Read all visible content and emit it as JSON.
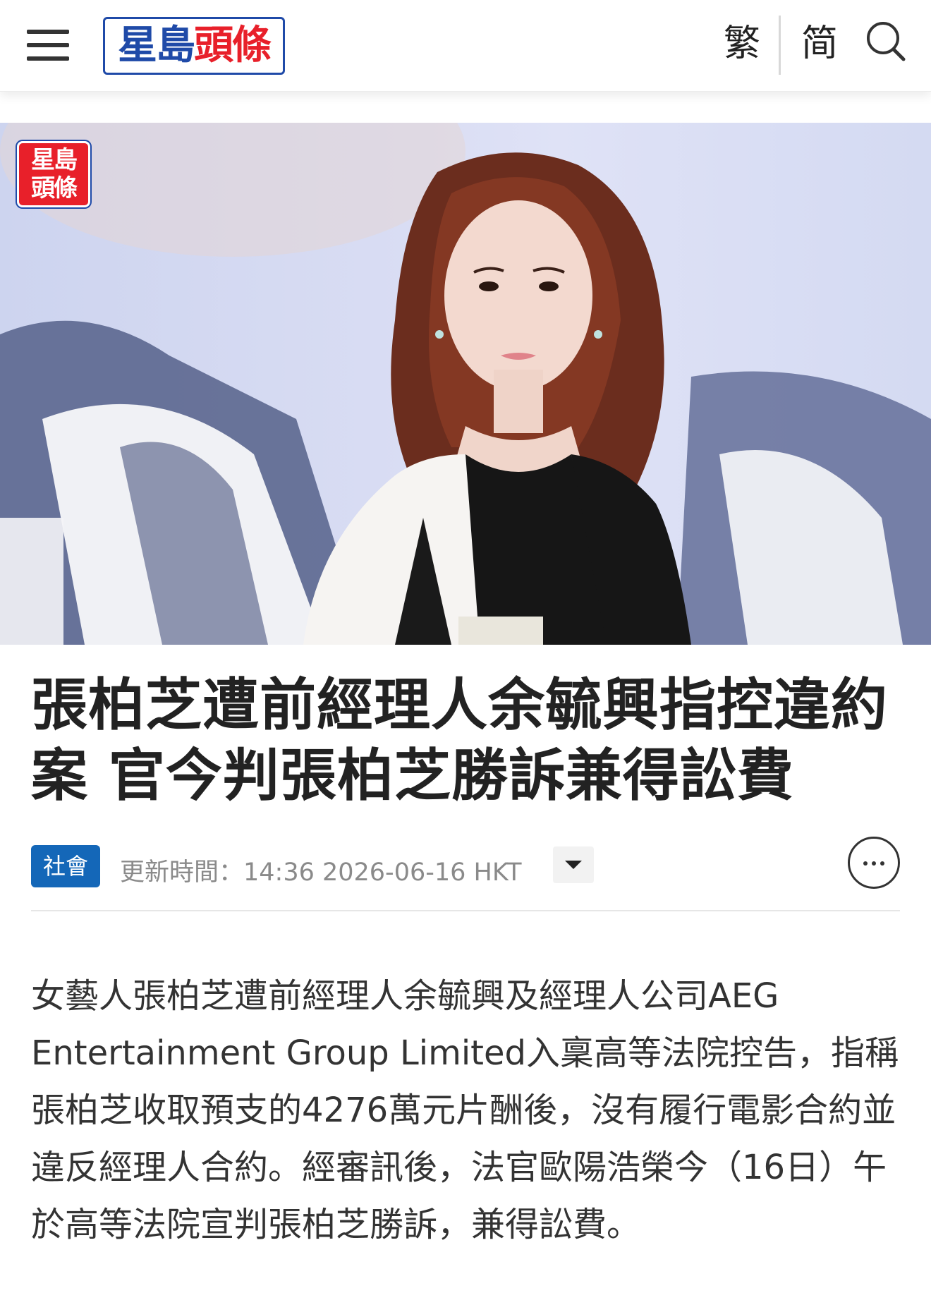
{
  "header": {
    "menu_icon": "hamburger-menu-icon",
    "logo_text_part1": "星島",
    "logo_text_part2": "頭條",
    "lang_traditional": "繁",
    "lang_simplified": "简",
    "search_icon": "search-icon"
  },
  "hero": {
    "watermark_line1": "星島",
    "watermark_line2": "頭條"
  },
  "article": {
    "headline": "張柏芝遭前經理人余毓興指控違約案 官今判張柏芝勝訴兼得訟費",
    "category": "社會",
    "update_time": "更新時間：14:36 2026-06-16 HKT",
    "expand_icon": "caret-down-icon",
    "more_icon": "more-options-icon",
    "body": "女藝人張柏芝遭前經理人余毓興及經理人公司AEG Entertainment Group Limited入稟高等法院控告，指稱張柏芝收取預支的4276萬元片酬後，沒有履行電影合約並違反經理人合約。經審訊後，法官歐陽浩榮今（16日）午於高等法院宣判張柏芝勝訴，兼得訟費。"
  },
  "colors": {
    "brand_blue": "#1f4aa8",
    "brand_red": "#e8202a",
    "category_badge": "#1467b8"
  }
}
